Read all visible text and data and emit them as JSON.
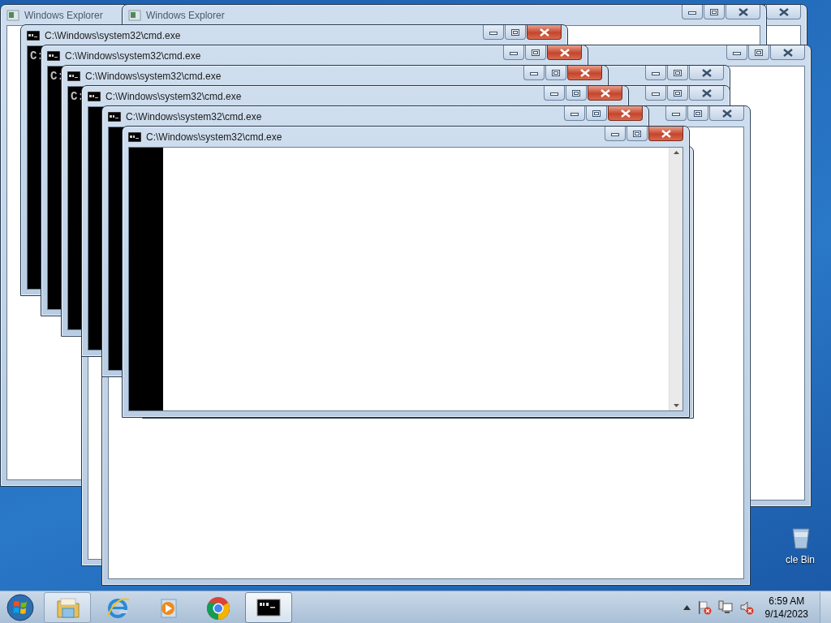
{
  "windows": [
    {
      "kind": "explorer",
      "title": "Windows Explorer"
    },
    {
      "kind": "explorer",
      "title": "Windows Explorer"
    },
    {
      "kind": "cmd",
      "title": "C:\\Windows\\system32\\cmd.exe",
      "console_text": "C:"
    },
    {
      "kind": "cmd",
      "title": "C:\\Windows\\system32\\cmd.exe",
      "console_text": "C:"
    },
    {
      "kind": "cmd",
      "title": "C:\\Windows\\system32\\cmd.exe",
      "console_text": "C:"
    },
    {
      "kind": "cmd",
      "title": "C:\\Windows\\system32\\cmd.exe"
    },
    {
      "kind": "cmd",
      "title": "C:\\Windows\\system32\\cmd.exe"
    },
    {
      "kind": "cmd",
      "title": "C:\\Windows\\system32\\cmd.exe"
    }
  ],
  "desktop_icons": [
    {
      "label": "cle Bin"
    }
  ],
  "taskbar": {
    "items": [
      {
        "kind": "explorer",
        "running": true,
        "selected": false
      },
      {
        "kind": "ie",
        "running": false,
        "selected": false
      },
      {
        "kind": "media",
        "running": false,
        "selected": false
      },
      {
        "kind": "chrome",
        "running": false,
        "selected": false
      },
      {
        "kind": "cmd",
        "running": true,
        "selected": true
      }
    ],
    "clock": {
      "time": "6:59 AM",
      "date": "9/14/2023"
    }
  }
}
